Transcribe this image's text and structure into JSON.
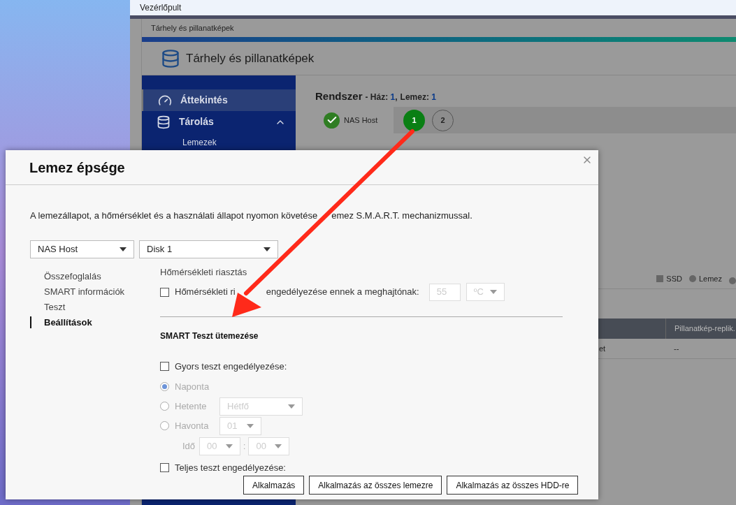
{
  "desktop_window": {
    "title": "Vezérlőpult"
  },
  "app": {
    "title_bar": "Tárhely és pillanatképek",
    "header_title": "Tárhely és pillanatképek",
    "sidebar": [
      {
        "label": "Áttekintés",
        "kind": "overview",
        "selected": true,
        "expanded": false
      },
      {
        "label": "Tárolás",
        "kind": "storage",
        "selected": false,
        "expanded": true,
        "children": [
          {
            "label": "Lemezek",
            "selected": false
          }
        ]
      }
    ],
    "system": {
      "title": "Rendszer",
      "summary": [
        {
          "label": "- Ház:",
          "value": "1",
          "suffix": ","
        },
        {
          "label": "Lemez:",
          "value": "1"
        }
      ]
    },
    "host": {
      "label": "NAS Host",
      "ok": true
    },
    "enclosures": [
      {
        "label": "1",
        "selected": true
      },
      {
        "label": "2",
        "selected": false
      }
    ],
    "legend": [
      {
        "label": "SSD",
        "kind": "square"
      },
      {
        "label": "Lemez",
        "kind": "circle"
      },
      {
        "kind": "circle"
      }
    ],
    "table": {
      "columns": [
        "",
        "Pillanatkép-replik."
      ],
      "rows": [
        [
          "et",
          "--"
        ]
      ]
    }
  },
  "dialog": {
    "title": "Lemez épsége",
    "description": [
      "A lemezállapot, a hőmérséklet és a használati állapot nyomon követése",
      "emez S.M.A.R.T. mechanizmussal."
    ],
    "host_select": "NAS Host",
    "disk_select": "Disk 1",
    "nav": [
      {
        "label": "Összefoglalás",
        "selected": false
      },
      {
        "label": "SMART információk",
        "selected": false
      },
      {
        "label": "Teszt",
        "selected": false
      },
      {
        "label": "Beállítások",
        "selected": true
      }
    ],
    "temperature": {
      "heading": "Hőmérsékleti riasztás",
      "label": [
        "Hőmérsékleti ri",
        "engedélyezése ennek a meghajtónak:"
      ],
      "checked": false,
      "value": "55",
      "unit": "ºC",
      "disabled": true
    },
    "smart": {
      "heading": "SMART Teszt ütemezése",
      "quick": {
        "label": "Gyors teszt engedélyezése:",
        "checked": false
      },
      "disabled": true,
      "schedule": [
        {
          "label": "Naponta",
          "selected": true
        },
        {
          "label": "Hetente",
          "selected": false,
          "select": "Hétfő"
        },
        {
          "label": "Havonta",
          "selected": false,
          "select": "01"
        }
      ],
      "time": {
        "label": "Idő",
        "hour": "00",
        "separator": ":",
        "minute": "00"
      },
      "full": {
        "label": "Teljes teszt engedélyezése:",
        "checked": false
      }
    },
    "buttons": [
      "Alkalmazás",
      "Alkalmazás az összes lemezre",
      "Alkalmazás az összes HDD-re"
    ]
  }
}
